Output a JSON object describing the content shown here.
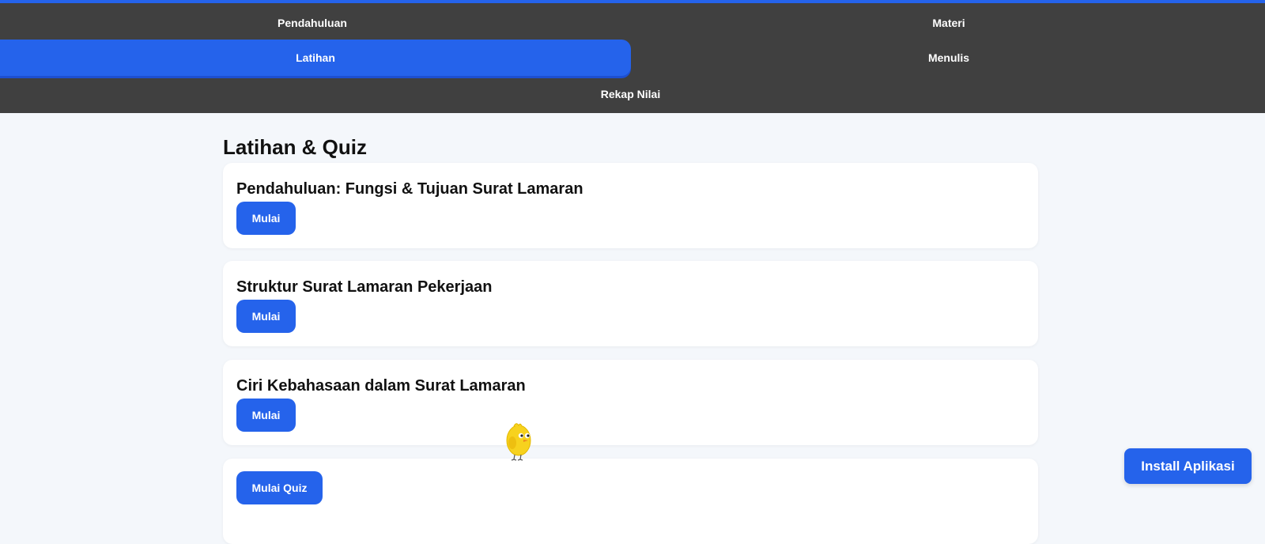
{
  "nav": {
    "items": [
      {
        "label": "Pendahuluan",
        "active": false
      },
      {
        "label": "Materi",
        "active": false
      },
      {
        "label": "Latihan",
        "active": true
      },
      {
        "label": "Menulis",
        "active": false
      },
      {
        "label": "Rekap Nilai",
        "active": false
      }
    ]
  },
  "colors": {
    "accent": "#2563eb",
    "nav_bg": "#404040",
    "page_bg": "#f4f7fb",
    "card_bg": "#ffffff"
  },
  "main": {
    "title": "Latihan & Quiz",
    "cards": [
      {
        "title": "Pendahuluan: Fungsi & Tujuan Surat Lamaran",
        "button_label": "Mulai"
      },
      {
        "title": "Struktur Surat Lamaran Pekerjaan",
        "button_label": "Mulai"
      },
      {
        "title": "Ciri Kebahasaan dalam Surat Lamaran",
        "button_label": "Mulai"
      }
    ],
    "quiz_card": {
      "button_label": "Mulai Quiz"
    }
  },
  "install": {
    "label": "Install Aplikasi"
  },
  "mascot": {
    "icon": "chick-mascot-icon"
  }
}
